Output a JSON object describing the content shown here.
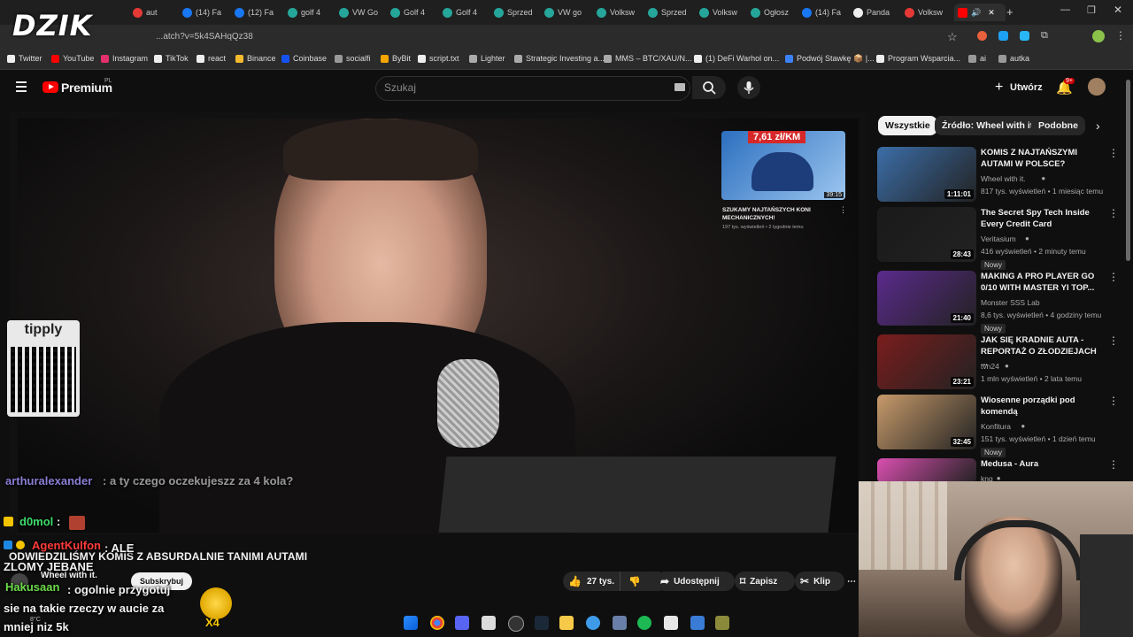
{
  "browser": {
    "tabs": [
      {
        "label": "aut",
        "color": "#e53935"
      },
      {
        "label": "(14) Fa",
        "color": "#1877f2"
      },
      {
        "label": "(12) Fa",
        "color": "#1877f2"
      },
      {
        "label": "golf 4",
        "color": "#26a69a"
      },
      {
        "label": "VW Go",
        "color": "#26a69a"
      },
      {
        "label": "Golf 4",
        "color": "#26a69a"
      },
      {
        "label": "Golf 4",
        "color": "#26a69a"
      },
      {
        "label": "Sprzed",
        "color": "#26a69a"
      },
      {
        "label": "VW go",
        "color": "#26a69a"
      },
      {
        "label": "Volksw",
        "color": "#26a69a"
      },
      {
        "label": "Sprzed",
        "color": "#26a69a"
      },
      {
        "label": "Volksw",
        "color": "#26a69a"
      },
      {
        "label": "Ogłosz",
        "color": "#26a69a"
      },
      {
        "label": "(14) Fa",
        "color": "#1877f2"
      },
      {
        "label": "Panda",
        "color": "#eeeeee"
      },
      {
        "label": "Volksw",
        "color": "#e53935"
      }
    ],
    "url": "...atch?v=5k4SAHqQz38",
    "bookmarks": [
      "Twitter",
      "YouTube",
      "Instagram",
      "TikTok",
      "react",
      "Binance",
      "Coinbase",
      "socialfi",
      "ByBit",
      "script.txt",
      "Lighter",
      "Strategic Investing a...",
      "MMS – BTC/XAU/N...",
      "(1) DeFi Warhol on...",
      "Podwój Stawkę 📦 |...",
      "Program Wsparcia...",
      "ai",
      "autka"
    ]
  },
  "overlay": {
    "logo": "DZIK",
    "tipply": "tipply"
  },
  "youtube": {
    "brand": "Premium",
    "brand_region": "PL",
    "search_placeholder": "Szukaj",
    "create_label": "Utwórz",
    "notif_count": "9+",
    "chips": [
      "Wszystkie",
      "Źródło: Wheel with it.",
      "Podobne"
    ],
    "endscreen": {
      "price": "7,61 zł/KM",
      "duration": "39:15",
      "title": "SZUKAMY NAJTAŃSZYCH KONI MECHANICZNYCH!",
      "meta": "197 tys. wyświetleń • 2 tygodnie temu"
    },
    "video_title": "ODWIEDZILIŚMY KOMIS Z ABSURDALNIE TANIMI AUTAMI",
    "channel": "Wheel with it.",
    "subscribe": "Subskrybuj",
    "actions": {
      "likes": "27 tys.",
      "share": "Udostępnij",
      "save": "Zapisz",
      "clip": "Klip"
    },
    "recommendations": [
      {
        "title": "KOMIS Z NAJTAŃSZYMI AUTAMI W POLSCE?",
        "channel": "Wheel with it.",
        "meta": "817 tys. wyświetleń • 1 miesiąc temu",
        "duration": "1:11:01",
        "badge": "",
        "thumb": "#3b6ea8"
      },
      {
        "title": "The Secret Spy Tech Inside Every Credit Card",
        "channel": "Veritasium",
        "meta": "416 wyświetleń • 2 minuty temu",
        "duration": "28:43",
        "badge": "Nowy",
        "thumb": "#1a1a1a"
      },
      {
        "title": "MAKING A PRO PLAYER GO 0/10 WITH MASTER YI TOP...",
        "channel": "Monster SSS Lab",
        "meta": "8,6 tys. wyświetleń • 4 godziny temu",
        "duration": "21:40",
        "badge": "Nowy",
        "thumb": "#5b2a8c"
      },
      {
        "title": "JAK SIĘ KRADNIE AUTA - REPORTAŻ O ZŁODZIEJACH ...",
        "channel": "tvn24",
        "meta": "1 mln wyświetleń • 2 lata temu",
        "duration": "23:21",
        "badge": "",
        "thumb": "#7a1d1d"
      },
      {
        "title": "Wiosenne porządki pod komendą",
        "channel": "Konfitura",
        "meta": "151 tys. wyświetleń • 1 dzień temu",
        "duration": "32:45",
        "badge": "Nowy",
        "thumb": "#c79a6b"
      },
      {
        "title": "Medusa - Aura",
        "channel": "kng",
        "meta": "",
        "duration": "",
        "badge": "",
        "thumb": "#d94fb0"
      }
    ]
  },
  "chat": [
    {
      "user": "arthuralexander",
      "msg": " : a ty czego oczekujeszz za 4 kola?",
      "color": "#8a7fd6"
    },
    {
      "user": "d0mol",
      "msg": " :",
      "color": "#3fdc6c"
    },
    {
      "user": "AgentKulfon",
      "msg": " : ALE ZLOMY JEBANE",
      "color": "#ff3b3b"
    },
    {
      "user": "Hakusaan",
      "msg": " : ogolnie przygotuj sie na takie rzeczy w aucie za mniej niz 5k",
      "color": "#6cdc4a"
    }
  ],
  "emote_count": "X4",
  "weather": "8°C"
}
